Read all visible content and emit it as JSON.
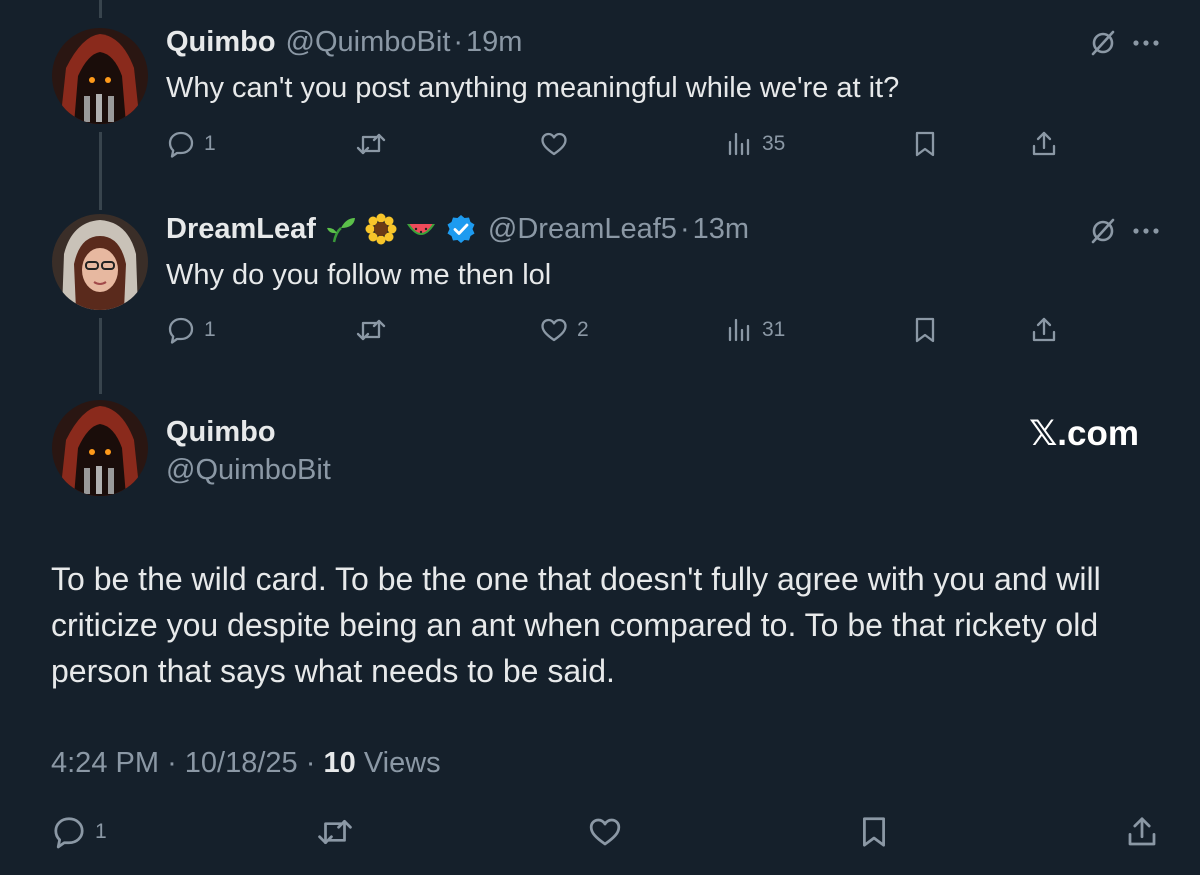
{
  "tweets": [
    {
      "display_name": "Quimbo",
      "handle": "@QuimboBit",
      "separator": "·",
      "time": "19m",
      "text": "Why can't you post anything meaningful while we're at it?",
      "replies": "1",
      "retweets": "",
      "likes": "",
      "views": "35"
    },
    {
      "display_name": "DreamLeaf",
      "emoji_badges": [
        "seedling",
        "sunflower",
        "watermelon"
      ],
      "verified": true,
      "handle": "@DreamLeaf5",
      "separator": "·",
      "time": "13m",
      "text": "Why do you follow me then lol",
      "replies": "1",
      "retweets": "",
      "likes": "2",
      "views": "31"
    }
  ],
  "main_tweet": {
    "display_name": "Quimbo",
    "handle": "@QuimboBit",
    "watermark": "𝕏.com",
    "text": "To be the wild card. To be the one that doesn't fully agree with you and will criticize you despite being an ant when compared to. To be that rickety old person that says what needs to be said.",
    "time": "4:24 PM",
    "separator": "·",
    "date": "10/18/25",
    "views_count": "10",
    "views_label": "Views",
    "replies": "1"
  },
  "colors": {
    "background": "#15202b",
    "text": "#e7e9ea",
    "muted": "#8b98a5",
    "thread_line": "#38444d",
    "verified": "#1d9bf0"
  },
  "icons": [
    "reply-icon",
    "retweet-icon",
    "like-icon",
    "views-icon",
    "bookmark-icon",
    "share-icon",
    "grok-icon",
    "more-icon",
    "verified-icon"
  ]
}
